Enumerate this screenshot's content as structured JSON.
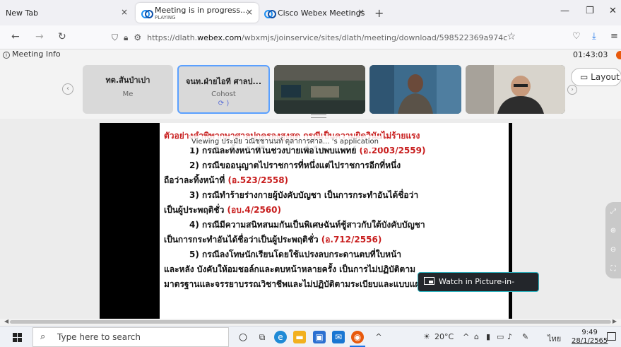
{
  "browser": {
    "tabs": [
      {
        "label": "New Tab",
        "sublabel": "",
        "close": "×"
      },
      {
        "label": "Meeting is in progress...",
        "sublabel": "PLAYING",
        "close": "×"
      },
      {
        "label": "Cisco Webex Meetings",
        "sublabel": "",
        "close": "×"
      }
    ],
    "new_tab": "+",
    "window": {
      "minimize": "—",
      "restore": "❐",
      "close": "✕"
    },
    "nav": {
      "back": "←",
      "forward": "→",
      "reload": "↻"
    },
    "url": {
      "prefix": "https://dlath.",
      "domain": "webex.com",
      "suffix": "/wbxmjs/joinservice/sites/dlath/meeting/download/598522369a974c"
    }
  },
  "meeting": {
    "info_label": "Meeting Info",
    "timer": "01:43:03",
    "layout_label": "Layout",
    "participants": [
      {
        "name": "ทต.สันป่าเปา",
        "role": "Me",
        "status": ""
      },
      {
        "name": "จนท.ฝ่ายไอที ศาลป...",
        "role": "Cohost",
        "status": "⟳ )"
      }
    ],
    "videos": [
      "room-camera",
      "participant-camera-1",
      "participant-camera-2"
    ],
    "viewing_text": "Viewing ประมัย วณิชชานนท์ ตุลาการศาล... 's application",
    "pip_label": "Watch in Picture-in-Picture"
  },
  "slide": {
    "lines": [
      {
        "text": "ตัวอย่างคำพิพากษาศาลปกครองสูงสุด กรณีเป็นความผิดวินัยไม่ร้ายแรง",
        "ref": ""
      },
      {
        "text": "1) กรณีละทิ้งหน้าที่ในช่วงบ่ายเพื่อไปพบแพทย์ ",
        "ref": "(อ.2003/2559)"
      },
      {
        "text": "2) กรณีขออนุญาตไปราชการที่หนึ่งแต่ไปราชการอีกที่หนึ่ง",
        "ref": ""
      },
      {
        "text": "ถือว่าละทิ้งหน้าที่ ",
        "ref": "(อ.523/2558)"
      },
      {
        "text": "3) กรณีทำร้ายร่างกายผู้บังคับบัญชา เป็นการกระทำอันได้ชื่อว่า",
        "ref": ""
      },
      {
        "text": "เป็นผู้ประพฤติชั่ว ",
        "ref": "(อบ.4/2560)"
      },
      {
        "text": "4) กรณีมีความสนิทสนมกันเป็นพิเศษฉันท์ชู้สาวกับใต้บังคับบัญชา",
        "ref": ""
      },
      {
        "text": "เป็นการกระทำอันได้ชื่อว่าเป็นผู้ประพฤติชั่ว ",
        "ref": "(อ.712/2556)"
      },
      {
        "text": "5) กรณีลงโทษนักเรียนโดยใช้แปรงลบกระดานตบที่ใบหน้า",
        "ref": ""
      },
      {
        "text": "และหลัง บังคับให้อมชอล์กและตบหน้าหลายครั้ง เป็นการไม่ปฏิบัติตาม",
        "ref": ""
      },
      {
        "text": "มาตรฐานและจรรยาบรรณวิชาชีพและไม่ปฏิบัติตามระเบียบและแบบแผน",
        "ref": ""
      }
    ]
  },
  "taskbar": {
    "search_placeholder": "Type here to search",
    "weather": "20°C",
    "language": "ไทย",
    "time": "9:49",
    "date": "28/1/2565"
  },
  "colors": {
    "accent": "#1a73e8",
    "slide_red": "#c81e1e",
    "pip_border": "#2bb3c0"
  }
}
